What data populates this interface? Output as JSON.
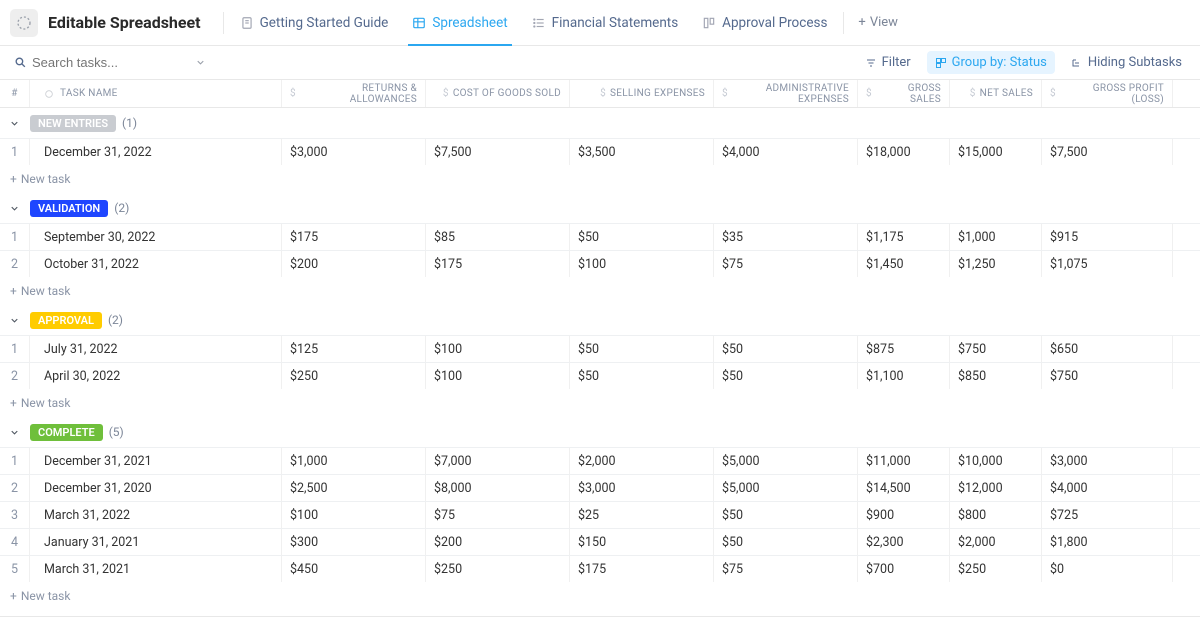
{
  "header": {
    "title": "Editable Spreadsheet",
    "tabs": [
      {
        "label": "Getting Started Guide",
        "active": false
      },
      {
        "label": "Spreadsheet",
        "active": true
      },
      {
        "label": "Financial Statements",
        "active": false
      },
      {
        "label": "Approval Process",
        "active": false
      }
    ],
    "add_view": "View"
  },
  "toolbar": {
    "search_placeholder": "Search tasks...",
    "filter": "Filter",
    "group_by": "Group by: Status",
    "hiding": "Hiding Subtasks"
  },
  "columns": {
    "num": "#",
    "name": "TASK NAME",
    "c1": "RETURNS & ALLOWANCES",
    "c2": "COST OF GOODS SOLD",
    "c3": "SELLING EXPENSES",
    "c4": "ADMINISTRATIVE EXPENSES",
    "c5": "GROSS SALES",
    "c6": "NET SALES",
    "c7": "GROSS PROFIT (LOSS)"
  },
  "groups": [
    {
      "label": "NEW ENTRIES",
      "color": "#c9ccd1",
      "count": "(1)",
      "rows": [
        {
          "n": "1",
          "name": "December 31, 2022",
          "c1": "$3,000",
          "c2": "$7,500",
          "c3": "$3,500",
          "c4": "$4,000",
          "c5": "$18,000",
          "c6": "$15,000",
          "c7": "$7,500"
        }
      ]
    },
    {
      "label": "VALIDATION",
      "color": "#1f46ff",
      "count": "(2)",
      "rows": [
        {
          "n": "1",
          "name": "September 30, 2022",
          "c1": "$175",
          "c2": "$85",
          "c3": "$50",
          "c4": "$35",
          "c5": "$1,175",
          "c6": "$1,000",
          "c7": "$915"
        },
        {
          "n": "2",
          "name": "October 31, 2022",
          "c1": "$200",
          "c2": "$175",
          "c3": "$100",
          "c4": "$75",
          "c5": "$1,450",
          "c6": "$1,250",
          "c7": "$1,075"
        }
      ]
    },
    {
      "label": "APPROVAL",
      "color": "#ffcc00",
      "count": "(2)",
      "rows": [
        {
          "n": "1",
          "name": "July 31, 2022",
          "c1": "$125",
          "c2": "$100",
          "c3": "$50",
          "c4": "$50",
          "c5": "$875",
          "c6": "$750",
          "c7": "$650"
        },
        {
          "n": "2",
          "name": "April 30, 2022",
          "c1": "$250",
          "c2": "$100",
          "c3": "$50",
          "c4": "$50",
          "c5": "$1,100",
          "c6": "$850",
          "c7": "$750"
        }
      ]
    },
    {
      "label": "COMPLETE",
      "color": "#6fbf3b",
      "count": "(5)",
      "rows": [
        {
          "n": "1",
          "name": "December 31, 2021",
          "c1": "$1,000",
          "c2": "$7,000",
          "c3": "$2,000",
          "c4": "$5,000",
          "c5": "$11,000",
          "c6": "$10,000",
          "c7": "$3,000"
        },
        {
          "n": "2",
          "name": "December 31, 2020",
          "c1": "$2,500",
          "c2": "$8,000",
          "c3": "$3,000",
          "c4": "$5,000",
          "c5": "$14,500",
          "c6": "$12,000",
          "c7": "$4,000"
        },
        {
          "n": "3",
          "name": "March 31, 2022",
          "c1": "$100",
          "c2": "$75",
          "c3": "$25",
          "c4": "$50",
          "c5": "$900",
          "c6": "$800",
          "c7": "$725"
        },
        {
          "n": "4",
          "name": "January 31, 2021",
          "c1": "$300",
          "c2": "$200",
          "c3": "$150",
          "c4": "$50",
          "c5": "$2,300",
          "c6": "$2,000",
          "c7": "$1,800"
        },
        {
          "n": "5",
          "name": "March 31, 2021",
          "c1": "$450",
          "c2": "$250",
          "c3": "$175",
          "c4": "$75",
          "c5": "$700",
          "c6": "$250",
          "c7": "$0"
        }
      ]
    }
  ],
  "new_task_label": "New task"
}
